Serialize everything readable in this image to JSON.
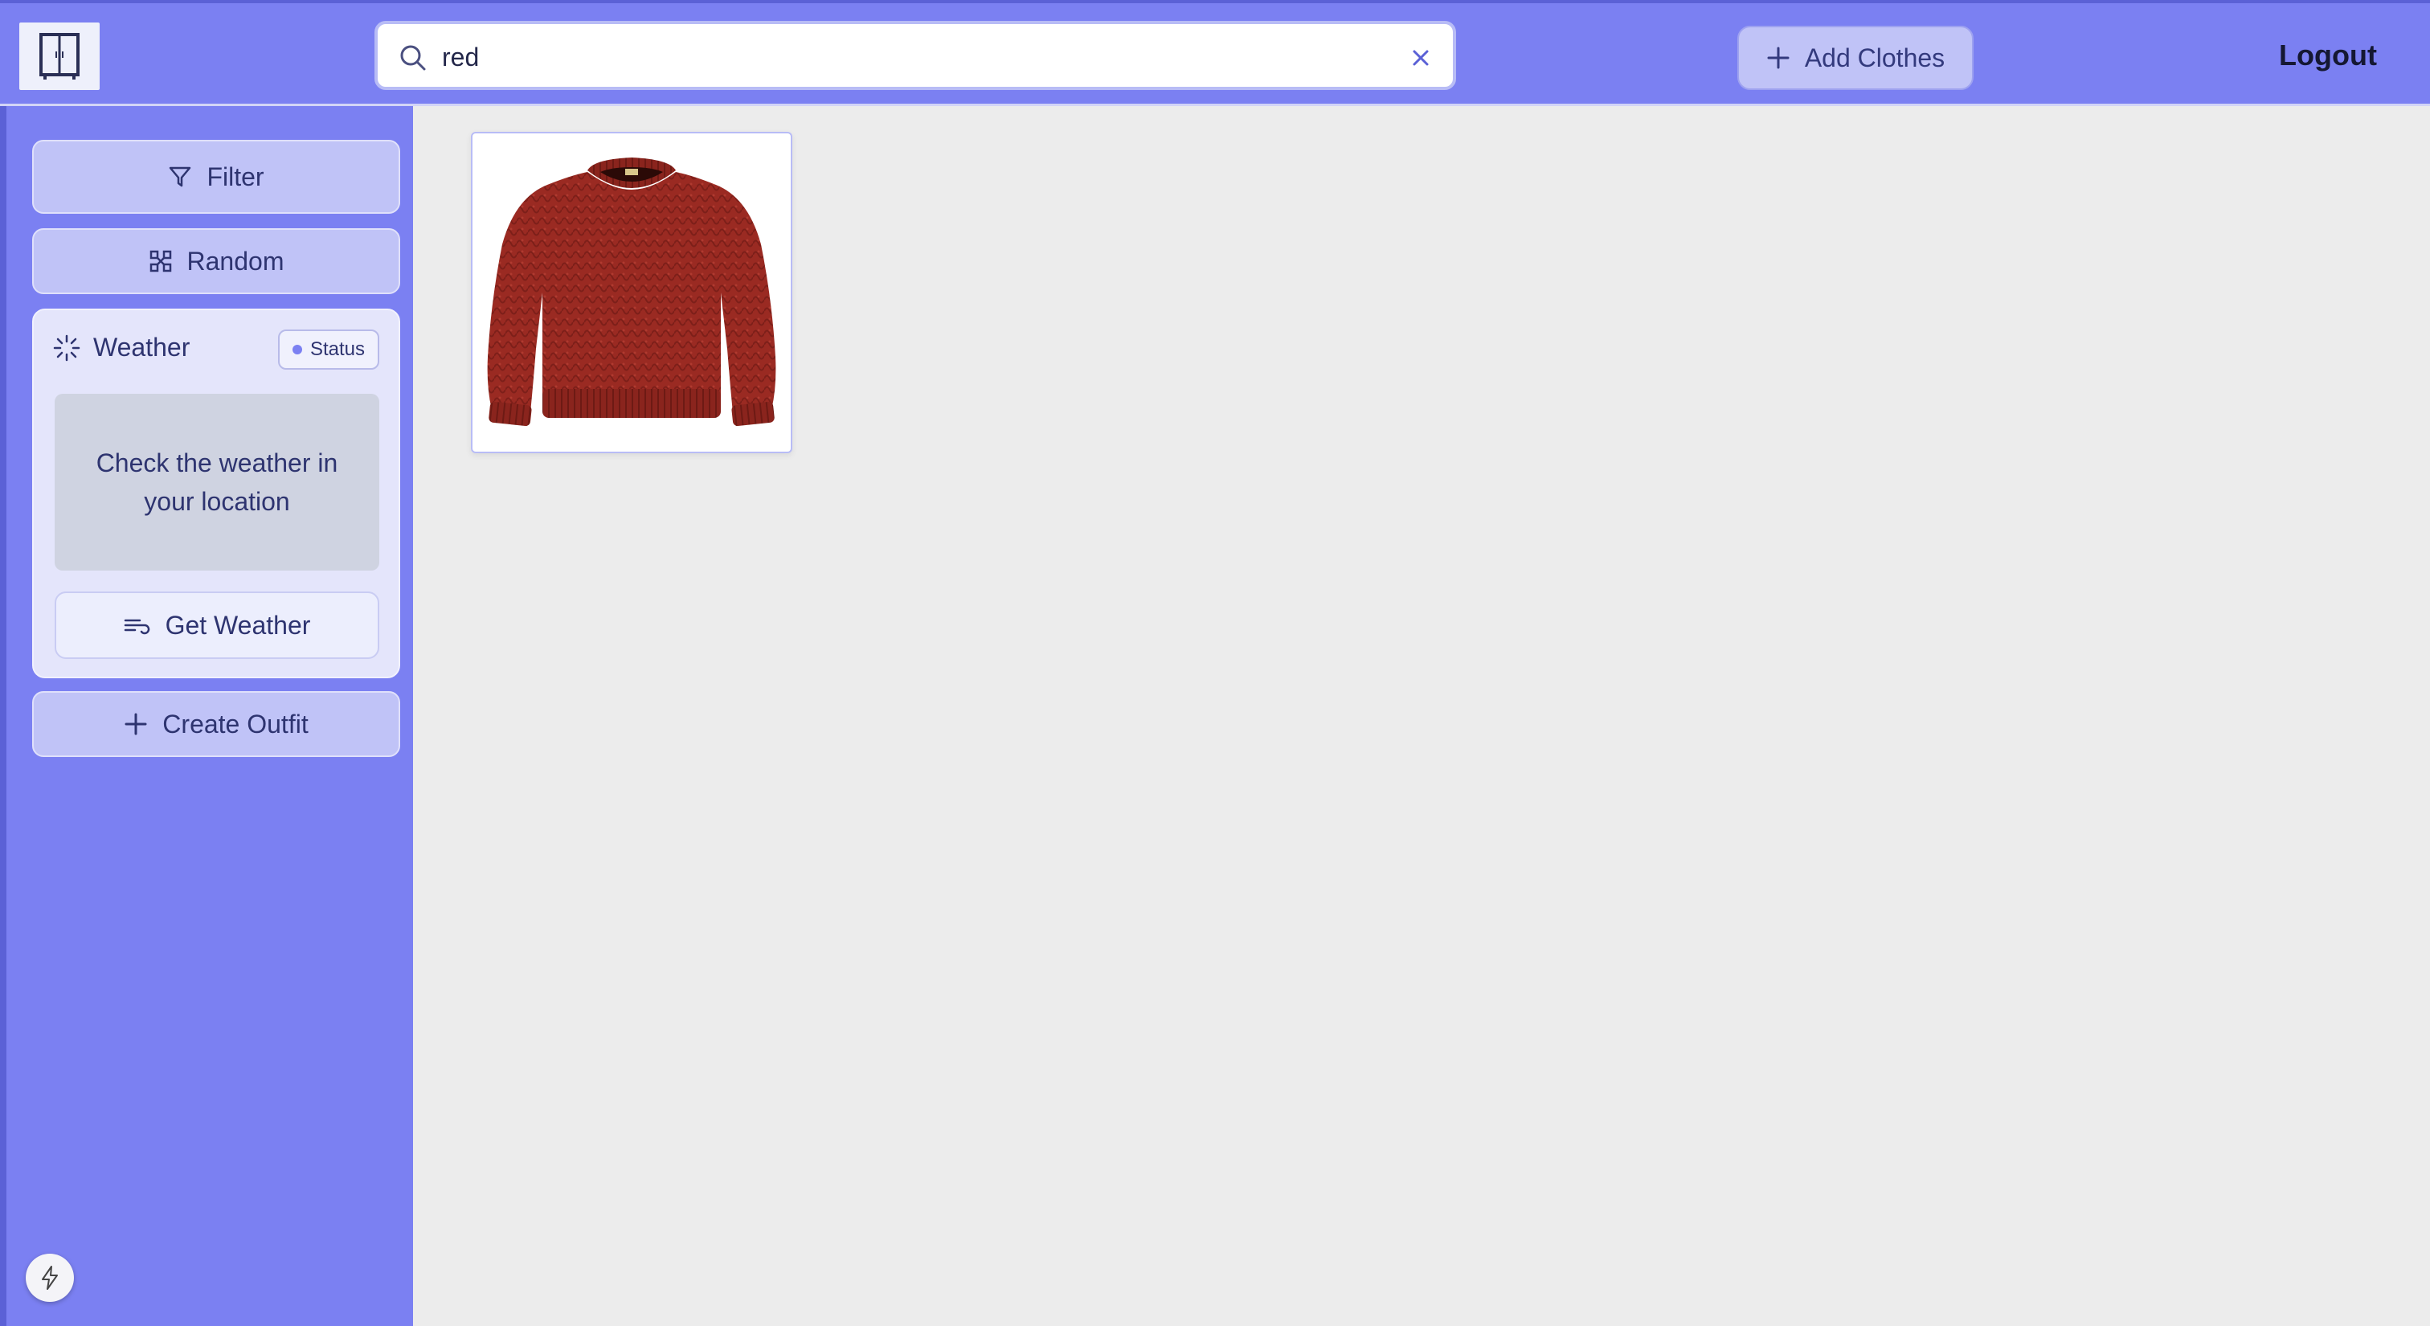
{
  "header": {
    "logo_icon": "wardrobe-icon",
    "search": {
      "value": "red",
      "placeholder": ""
    },
    "add_clothes_label": "Add Clothes",
    "logout_label": "Logout"
  },
  "sidebar": {
    "filter_label": "Filter",
    "random_label": "Random",
    "weather": {
      "title": "Weather",
      "status_label": "Status",
      "message": "Check the weather in your location",
      "button_label": "Get Weather"
    },
    "create_outfit_label": "Create Outfit"
  },
  "main": {
    "items": [
      {
        "name": "red sweater",
        "icon": "sweater-image"
      }
    ]
  },
  "colors": {
    "accent": "#7b80f2",
    "button_bg": "#c0c3f7",
    "content_bg": "#ececec"
  }
}
